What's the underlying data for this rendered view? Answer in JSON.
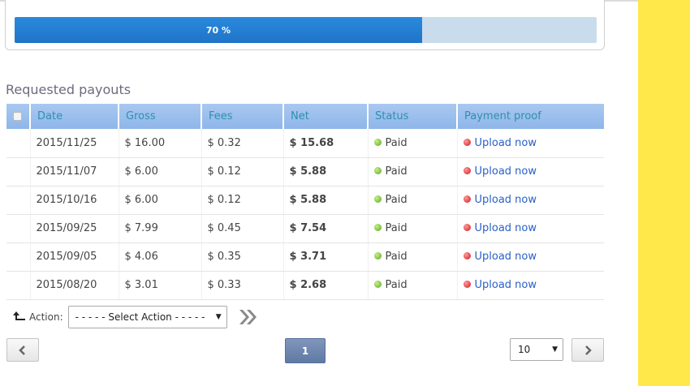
{
  "progress": {
    "percent_label": "70 %",
    "fraction": 0.7
  },
  "section": {
    "title": "Requested payouts"
  },
  "table": {
    "headers": [
      "Date",
      "Gross",
      "Fees",
      "Net",
      "Status",
      "Payment proof"
    ],
    "rows": [
      {
        "date": "2015/11/25",
        "gross": "$ 16.00",
        "fees": "$ 0.32",
        "net": "$ 15.68",
        "status": "Paid",
        "proof": "Upload now"
      },
      {
        "date": "2015/11/07",
        "gross": "$ 6.00",
        "fees": "$ 0.12",
        "net": "$ 5.88",
        "status": "Paid",
        "proof": "Upload now"
      },
      {
        "date": "2015/10/16",
        "gross": "$ 6.00",
        "fees": "$ 0.12",
        "net": "$ 5.88",
        "status": "Paid",
        "proof": "Upload now"
      },
      {
        "date": "2015/09/25",
        "gross": "$ 7.99",
        "fees": "$ 0.45",
        "net": "$ 7.54",
        "status": "Paid",
        "proof": "Upload now"
      },
      {
        "date": "2015/09/05",
        "gross": "$ 4.06",
        "fees": "$ 0.35",
        "net": "$ 3.71",
        "status": "Paid",
        "proof": "Upload now"
      },
      {
        "date": "2015/08/20",
        "gross": "$ 3.01",
        "fees": "$ 0.33",
        "net": "$ 2.68",
        "status": "Paid",
        "proof": "Upload now"
      }
    ]
  },
  "actions": {
    "label": "Action:",
    "select_value": "- - - - - Select Action - - - - -"
  },
  "pagination": {
    "current_page": "1",
    "per_page": "10"
  },
  "colors": {
    "accent_blue": "#1f74c8",
    "header_blue": "#8fb6ea",
    "status_paid": "#5aa51c",
    "proof_missing": "#d0161b",
    "side_yellow": "#ffe84a"
  }
}
